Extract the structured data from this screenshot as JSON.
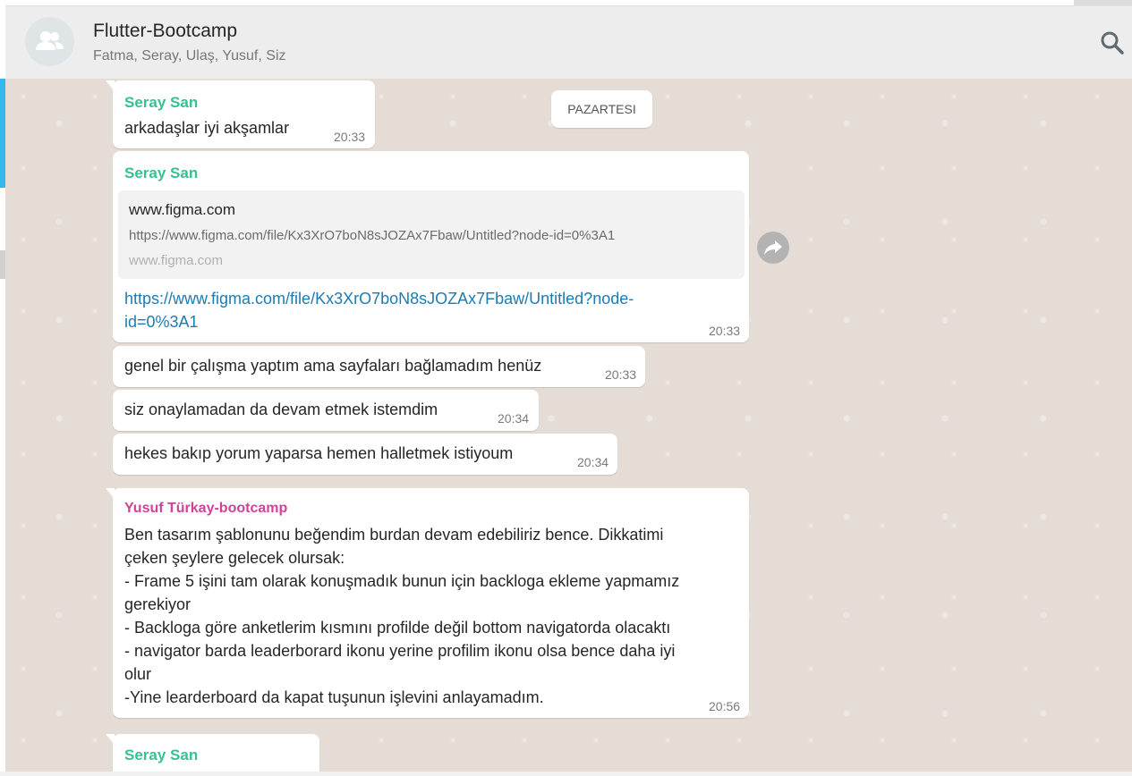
{
  "header": {
    "title": "Flutter-Bootcamp",
    "members": "Fatma, Seray, Ulaş, Yusuf, Siz",
    "avatar_icon": "group-icon",
    "search_icon": "search-icon"
  },
  "date_chip": "PAZARTESI",
  "messages": [
    {
      "sender": "Seray San",
      "text": "arkadaşlar iyi akşamlar",
      "time": "20:33"
    },
    {
      "sender": "Seray San",
      "preview": {
        "title": "www.figma.com",
        "description": "https://www.figma.com/file/Kx3XrO7boN8sJOZAx7Fbaw/Untitled?node-id=0%3A1",
        "domain": "www.figma.com"
      },
      "link_line1": "https://www.figma.com/file/Kx3XrO7boN8sJOZAx7Fbaw/Untitled?node-",
      "link_line2": "id=0%3A1",
      "time": "20:33"
    },
    {
      "text": "genel bir çalışma yaptım ama sayfaları bağlamadım henüz",
      "time": "20:33"
    },
    {
      "text": "siz onaylamadan da devam etmek istemdim",
      "time": "20:34"
    },
    {
      "text": "hekes bakıp yorum yaparsa hemen halletmek istiyoum",
      "time": "20:34"
    },
    {
      "sender": "Yusuf Türkay-bootcamp",
      "lines": [
        "Ben tasarım şablonunu beğendim burdan devam edebiliriz bence. Dikkatimi",
        "çeken şeylere gelecek olursak:",
        "- Frame 5 işini tam olarak konuşmadık bunun için backloga ekleme yapmamız",
        "gerekiyor",
        "- Backloga göre anketlerim kısmını profilde değil bottom navigatorda olacaktı",
        "- navigator barda leaderborard ikonu yerine profilim ikonu olsa bence daha iyi",
        "olur",
        "-Yine learderboard da kapat tuşunun işlevini anlayamadım."
      ],
      "time": "20:56"
    },
    {
      "sender": "Seray San"
    }
  ],
  "colors": {
    "chat_background": "#e5ddd5",
    "sender_green": "#35c095",
    "sender_pink": "#d1419a",
    "link": "#1d7bb3",
    "accent": "#34b7f1"
  }
}
